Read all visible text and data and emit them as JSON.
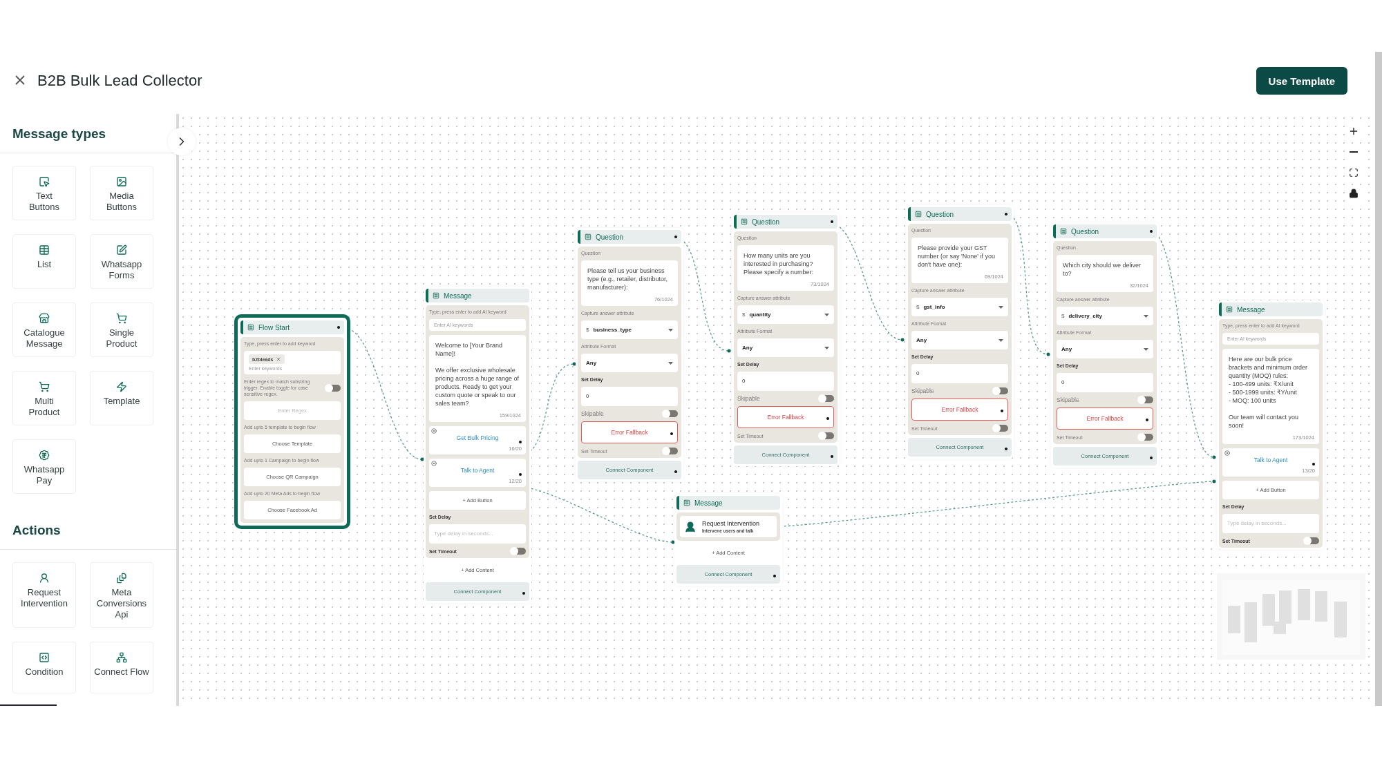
{
  "header": {
    "title": "B2B Bulk Lead Collector",
    "action": "Use Template"
  },
  "sidebar": {
    "sections": [
      {
        "title": "Message types",
        "items": [
          {
            "label": "Text\nButtons"
          },
          {
            "label": "Media\nButtons"
          },
          {
            "label": "List"
          },
          {
            "label": "Whatsapp\nForms"
          },
          {
            "label": "Catalogue\nMessage"
          },
          {
            "label": "Single\nProduct"
          },
          {
            "label": "Multi\nProduct"
          },
          {
            "label": "Template"
          },
          {
            "label": "Whatsapp\nPay"
          }
        ]
      },
      {
        "title": "Actions",
        "items": [
          {
            "label": "Request\nIntervention"
          },
          {
            "label": "Meta\nConversions\nApi"
          },
          {
            "label": "Condition"
          },
          {
            "label": "Connect Flow"
          }
        ]
      }
    ]
  },
  "nodes": [
    {
      "kind": "flow_start",
      "title": "Flow Start",
      "keyword_label": "Type, press enter to add keyword",
      "keywords": [
        "b2bleads"
      ],
      "keyword_placeholder": "Enter keywords",
      "regex_hint": "Enter regex to match substring trigger. Enable toggle for case sensitive regex.",
      "regex_case_sensitive": false,
      "regex_placeholder": "Enter Regex",
      "sections": [
        {
          "hint": "Add upto 5 template to begin flow",
          "action": "Choose Template"
        },
        {
          "hint": "Add upto 1 Campaign to begin flow",
          "action": "Choose QR Campaign"
        },
        {
          "hint": "Add upto 20 Meta Ads to begin flow",
          "action": "Choose Facebook Ad"
        }
      ]
    },
    {
      "kind": "message",
      "title": "Message",
      "contents": [
        {
          "kind": "text",
          "keyword_label": "Type, press enter to add AI keyword",
          "keyword_placeholder": "Enter AI keywords",
          "text": "Welcome to [Your Brand Name]!\n\nWe offer exclusive wholesale pricing across a huge range of products. Ready to get your custom quote or speak to our sales team?",
          "counter": "159/1024",
          "buttons": [
            {
              "label": "Get Bulk Pricing",
              "counter": "16/20"
            },
            {
              "label": "Talk to Agent",
              "counter": "12/20"
            }
          ],
          "add_button": "+ Add Button",
          "delay_label": "Set Delay",
          "delay_placeholder": "Type delay in seconds...",
          "timeout_label": "Set Timeout",
          "timeout": false
        }
      ],
      "add_content": "+ Add Content",
      "connect": "Connect Component"
    },
    {
      "kind": "question",
      "title": "Question",
      "question_label": "Question",
      "question": "Please tell us your business type (e.g., retailer, distributor, manufacturer):",
      "counter": "76/1024",
      "capture_label": "Capture answer attribute",
      "attribute_prefix": "$",
      "attribute": "business_type",
      "format_label": "Attribute Format",
      "format": "Any",
      "delay_label": "Set Delay",
      "delay": "0",
      "skippable_label": "Skipable",
      "skippable": false,
      "error_fallback": "Error Fallback",
      "timeout_label": "Set Timeout",
      "timeout": false,
      "connect": "Connect Component"
    },
    {
      "kind": "message",
      "title": "Message",
      "contents": [
        {
          "kind": "intervention",
          "title": "Request Intervention",
          "subtitle": "Intervene users and talk"
        }
      ],
      "add_content": "+ Add Content",
      "connect": "Connect Component"
    },
    {
      "kind": "question",
      "title": "Question",
      "question_label": "Question",
      "question": "How many units are you interested in purchasing? Please specify a number:",
      "counter": "73/1024",
      "capture_label": "Capture answer attribute",
      "attribute_prefix": "$",
      "attribute": "quantity",
      "format_label": "Attribute Format",
      "format": "Any",
      "delay_label": "Set Delay",
      "delay": "0",
      "skippable_label": "Skipable",
      "skippable": false,
      "error_fallback": "Error Fallback",
      "timeout_label": "Set Timeout",
      "timeout": false,
      "connect": "Connect Component"
    },
    {
      "kind": "question",
      "title": "Question",
      "question_label": "Question",
      "question": "Please provide your GST number (or say 'None' if you don't have one):",
      "counter": "69/1024",
      "capture_label": "Capture answer attribute",
      "attribute_prefix": "$",
      "attribute": "gst_info",
      "format_label": "Attribute Format",
      "format": "Any",
      "delay_label": "Set Delay",
      "delay": "0",
      "skippable_label": "Skipable",
      "skippable": false,
      "error_fallback": "Error Fallback",
      "timeout_label": "Set Timeout",
      "timeout": false,
      "connect": "Connect Component"
    },
    {
      "kind": "question",
      "title": "Question",
      "question_label": "Question",
      "question": "Which city should we deliver to?",
      "counter": "32/1024",
      "capture_label": "Capture answer attribute",
      "attribute_prefix": "$",
      "attribute": "delivery_city",
      "format_label": "Attribute Format",
      "format": "Any",
      "delay_label": "Set Delay",
      "delay": "0",
      "skippable_label": "Skipable",
      "skippable": false,
      "error_fallback": "Error Fallback",
      "timeout_label": "Set Timeout",
      "timeout": false,
      "connect": "Connect Component"
    },
    {
      "kind": "message",
      "title": "Message",
      "contents": [
        {
          "kind": "text",
          "keyword_label": "Type, press enter to add AI keyword",
          "keyword_placeholder": "Enter AI keywords",
          "text": "Here are our bulk price brackets and minimum order quantity (MOQ) rules:\n- 100-499 units: ₹X/unit\n- 500-1999 units: ₹Y/unit\n- MOQ: 100 units\n\nOur team will contact you soon!",
          "counter": "173/1024",
          "buttons": [
            {
              "label": "Talk to Agent",
              "counter": "13/20"
            }
          ],
          "add_button": "+ Add Button",
          "delay_label": "Set Delay",
          "delay_placeholder": "Type delay in seconds...",
          "timeout_label": "Set Timeout",
          "timeout": false
        }
      ]
    }
  ]
}
